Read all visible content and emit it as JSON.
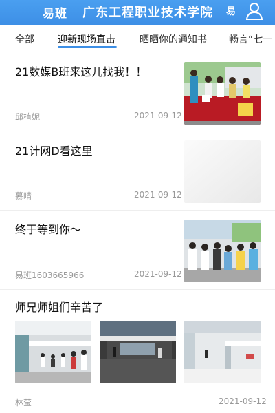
{
  "header": {
    "brand": "易班",
    "title": "广东工程职业技术学院",
    "brand_right": "易",
    "user_icon": "user-icon"
  },
  "tabs": [
    {
      "label": "全部"
    },
    {
      "label": "迎新现场直击",
      "active": true
    },
    {
      "label": "晒晒你的通知书"
    },
    {
      "label": "畅言“七一"
    }
  ],
  "articles": [
    {
      "title": "21数媒B班来这儿找我！！",
      "author": "邱植妮",
      "date": "2021-09-12",
      "thumb": "registration-desk-photo"
    },
    {
      "title": "21计网D看这里",
      "author": "慕晴",
      "date": "2021-09-12",
      "thumb": "blank-photo"
    },
    {
      "title": "终于等到你～",
      "author": "易班1603665966",
      "date": "2021-09-12",
      "thumb": "students-crowd-photo"
    },
    {
      "title": "师兄师姐们辛苦了",
      "author": "林莹",
      "date": "2021-09-12",
      "thumbs": [
        "hallway-line-photo",
        "building-entrance-photo",
        "campus-hall-photo"
      ]
    }
  ],
  "colors": {
    "accent": "#3d8fe6",
    "muted": "#999999"
  }
}
